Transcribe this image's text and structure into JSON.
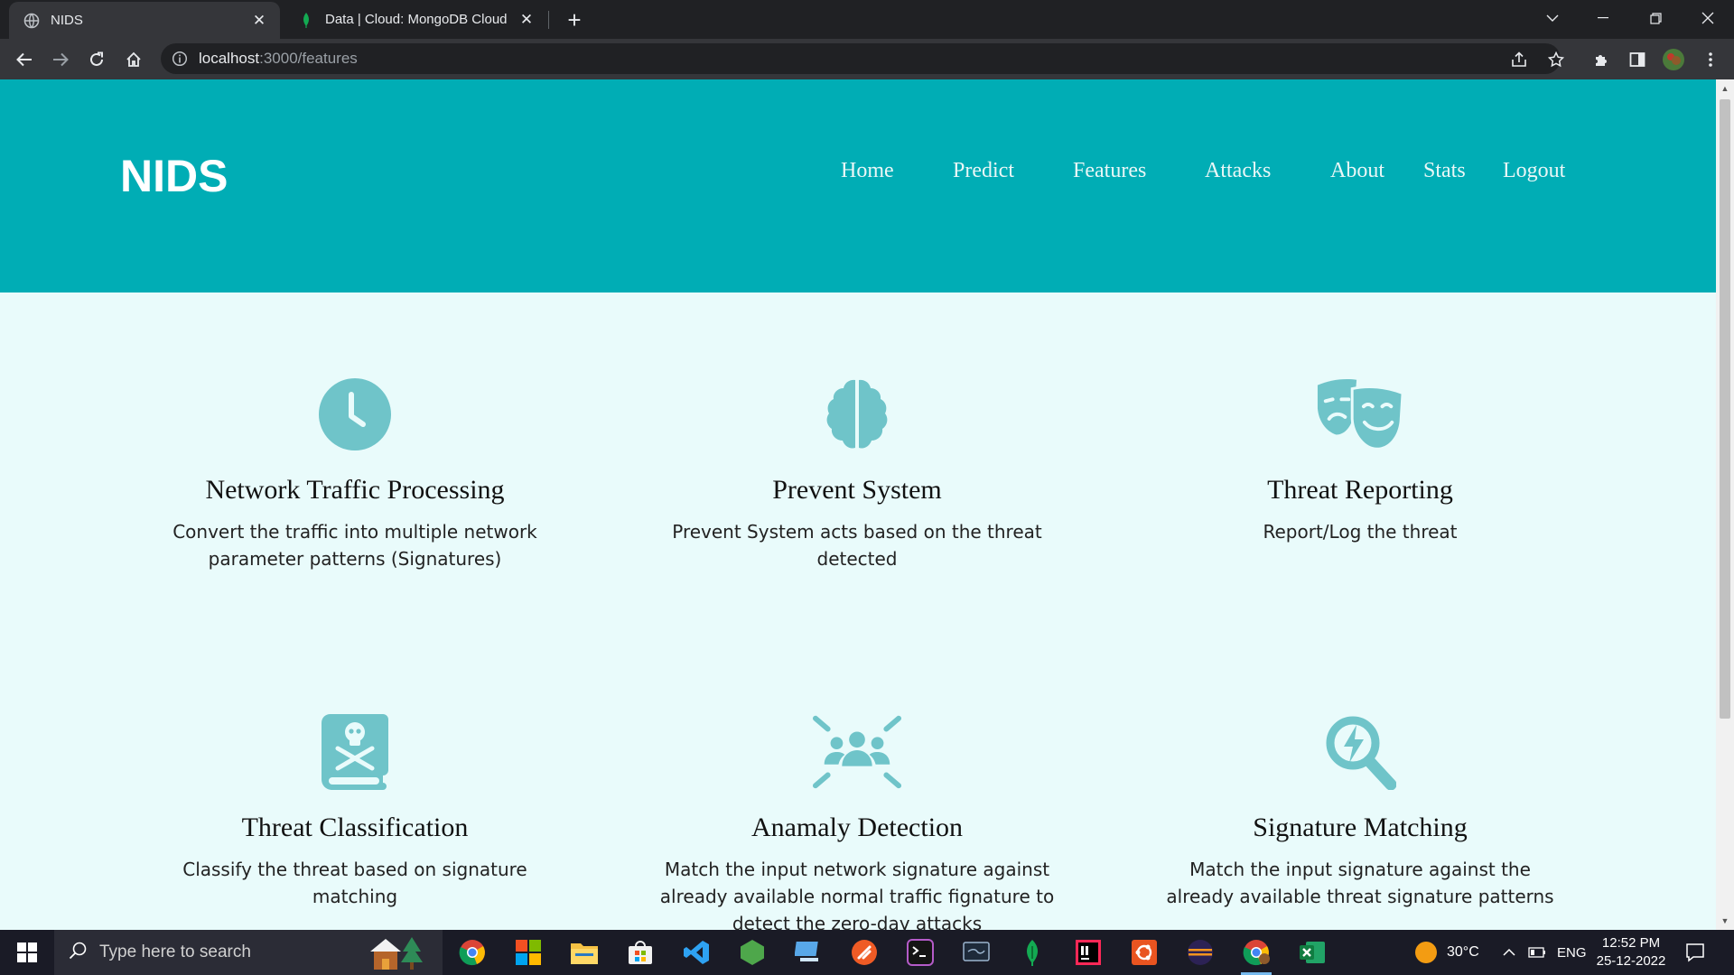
{
  "browser": {
    "tabs": [
      {
        "title": "NIDS",
        "active": true
      },
      {
        "title": "Data | Cloud: MongoDB Cloud",
        "active": false
      }
    ],
    "url_host": "localhost",
    "url_path": ":3000/features"
  },
  "site": {
    "brand": "NIDS",
    "nav": [
      "Home",
      "Predict",
      "Features",
      "Attacks",
      "About",
      "Stats",
      "Logout"
    ]
  },
  "features": [
    {
      "icon": "clock-icon",
      "title": "Network Traffic Processing",
      "desc": "Convert the traffic into multiple network parameter patterns (Signatures)"
    },
    {
      "icon": "brain-icon",
      "title": "Prevent System",
      "desc": "Prevent System acts based on the threat detected"
    },
    {
      "icon": "theater-masks-icon",
      "title": "Threat Reporting",
      "desc": "Report/Log the threat"
    },
    {
      "icon": "book-skull-icon",
      "title": "Threat Classification",
      "desc": "Classify the threat based on signature matching"
    },
    {
      "icon": "users-viewfinder-icon",
      "title": "Anamaly Detection",
      "desc": "Match the input network signature against already available normal traffic fignature to detect the zero-day attacks"
    },
    {
      "icon": "magnifying-glass-bolt-icon",
      "title": "Signature Matching",
      "desc": "Match the input signature against the already available threat signature patterns"
    }
  ],
  "taskbar": {
    "search_placeholder": "Type here to search",
    "temperature": "30°C",
    "language": "ENG",
    "time": "12:52 PM",
    "date": "25-12-2022"
  },
  "colors": {
    "header": "#00adb5",
    "page_bg": "#e9fbfb",
    "icon": "#6fc4c9"
  }
}
